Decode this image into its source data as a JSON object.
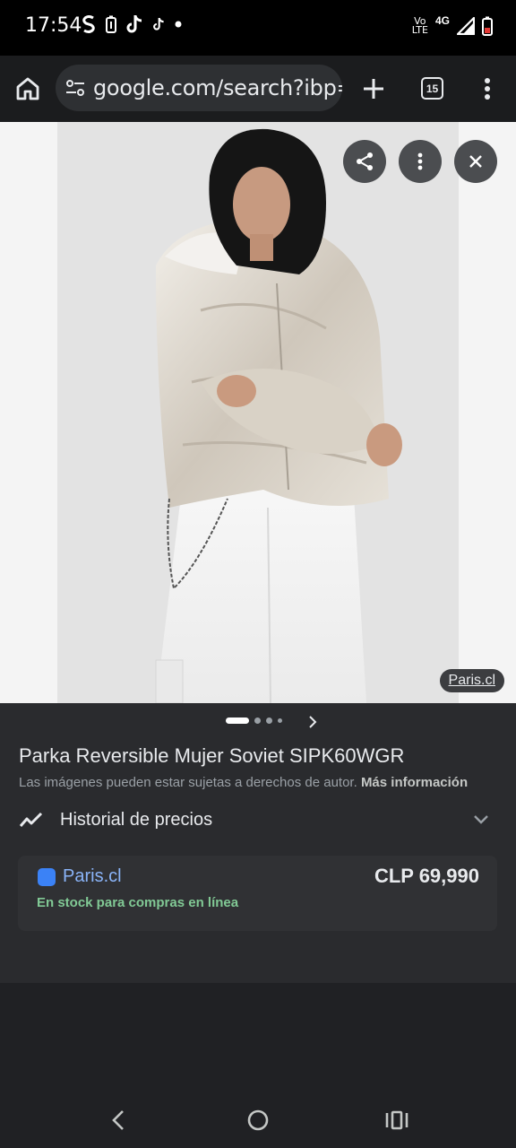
{
  "status_bar": {
    "time": "17:54",
    "left_icons": [
      "s-icon",
      "battery-saver-icon",
      "tiktok-icon",
      "tiktok-small-icon",
      "dot-icon"
    ],
    "network_label_top": "Vo",
    "network_label_bottom": "LTE",
    "network_type": "4G"
  },
  "browser": {
    "url": "google.com/search?ibp=gwp",
    "tab_count": "15"
  },
  "viewer": {
    "source_chip": "Paris.cl",
    "share_icon": "share-icon",
    "more_icon": "more-vert-icon",
    "close_icon": "close-icon"
  },
  "info": {
    "pager": {
      "total": 4,
      "current": 1
    },
    "title": "Parka Reversible Mujer Soviet SIPK60WGR",
    "copyright_text": "Las imágenes pueden estar sujetas a derechos de autor.",
    "copyright_link": "Más información",
    "price_history_label": "Historial de precios",
    "seller": {
      "name": "Paris.cl",
      "price": "CLP 69,990",
      "stock": "En stock para compras en línea"
    }
  },
  "colors": {
    "accent_link": "#8ab4f8",
    "stock_green": "#81c995",
    "panel_bg": "#2a2b2e",
    "card_bg": "#303134"
  }
}
